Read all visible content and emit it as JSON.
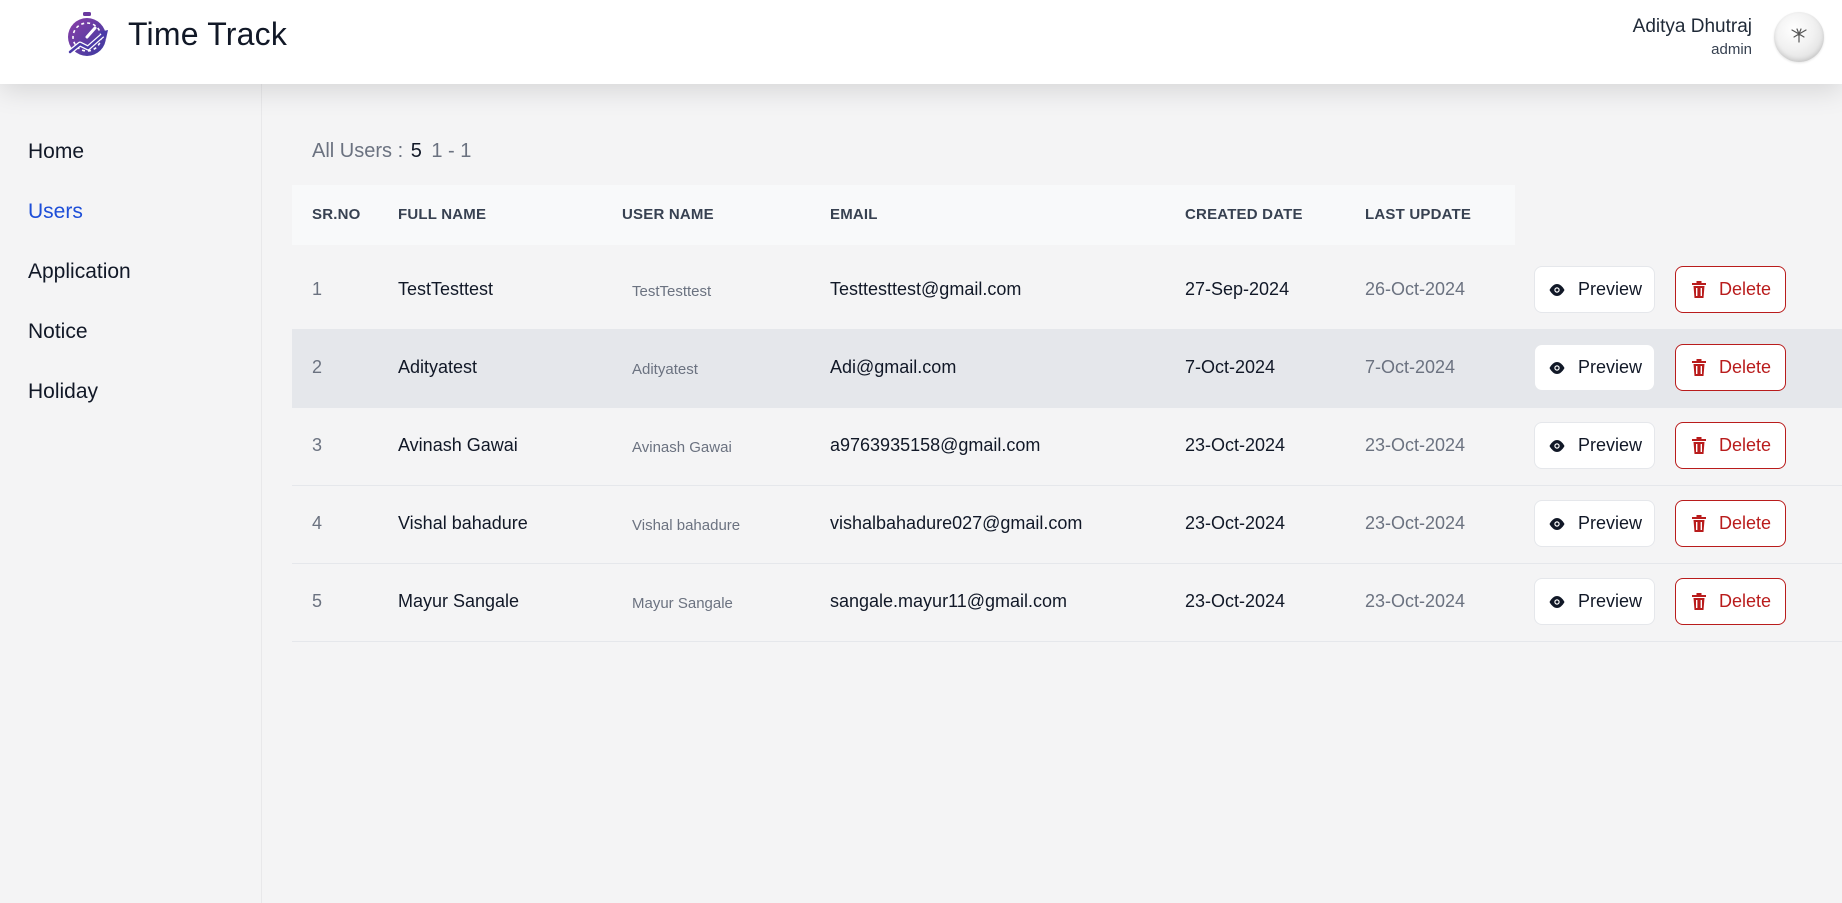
{
  "app": {
    "title": "Time Track",
    "logo": "stopwatch-chart-logo"
  },
  "user": {
    "name": "Aditya Dhutraj",
    "role": "admin",
    "avatar": "avatar-icon"
  },
  "sidebar": {
    "items": [
      {
        "label": "Home",
        "active": false
      },
      {
        "label": "Users",
        "active": true
      },
      {
        "label": "Application",
        "active": false
      },
      {
        "label": "Notice",
        "active": false
      },
      {
        "label": "Holiday",
        "active": false
      }
    ]
  },
  "summary": {
    "label": "All Users :",
    "count": "5",
    "range": "1 - 1"
  },
  "table": {
    "headers": [
      "SR.NO",
      "FULL NAME",
      "USER NAME",
      "EMAIL",
      "CREATED DATE",
      "LAST UPDATE"
    ],
    "rows": [
      {
        "sr": "1",
        "full_name": "TestTesttest",
        "user_name": "TestTesttest",
        "email": "Testtesttest@gmail.com",
        "created": "27-Sep-2024",
        "updated": "26-Oct-2024"
      },
      {
        "sr": "2",
        "full_name": "Adityatest",
        "user_name": "Adityatest",
        "email": "Adi@gmail.com",
        "created": "7-Oct-2024",
        "updated": "7-Oct-2024"
      },
      {
        "sr": "3",
        "full_name": "Avinash Gawai",
        "user_name": "Avinash Gawai",
        "email": "a9763935158@gmail.com",
        "created": "23-Oct-2024",
        "updated": "23-Oct-2024"
      },
      {
        "sr": "4",
        "full_name": "Vishal bahadure",
        "user_name": "Vishal bahadure",
        "email": "vishalbahadure027@gmail.com",
        "created": "23-Oct-2024",
        "updated": "23-Oct-2024"
      },
      {
        "sr": "5",
        "full_name": "Mayur Sangale",
        "user_name": "Mayur Sangale",
        "email": "sangale.mayur11@gmail.com",
        "created": "23-Oct-2024",
        "updated": "23-Oct-2024"
      }
    ],
    "highlighted_row": 2
  },
  "actions": {
    "preview_label": "Preview",
    "delete_label": "Delete",
    "preview_icon": "eye-icon",
    "delete_icon": "trash-icon"
  },
  "colors": {
    "accent": "#1d4ed8",
    "danger": "#b91c1c",
    "logo": "#5b3fa0"
  }
}
